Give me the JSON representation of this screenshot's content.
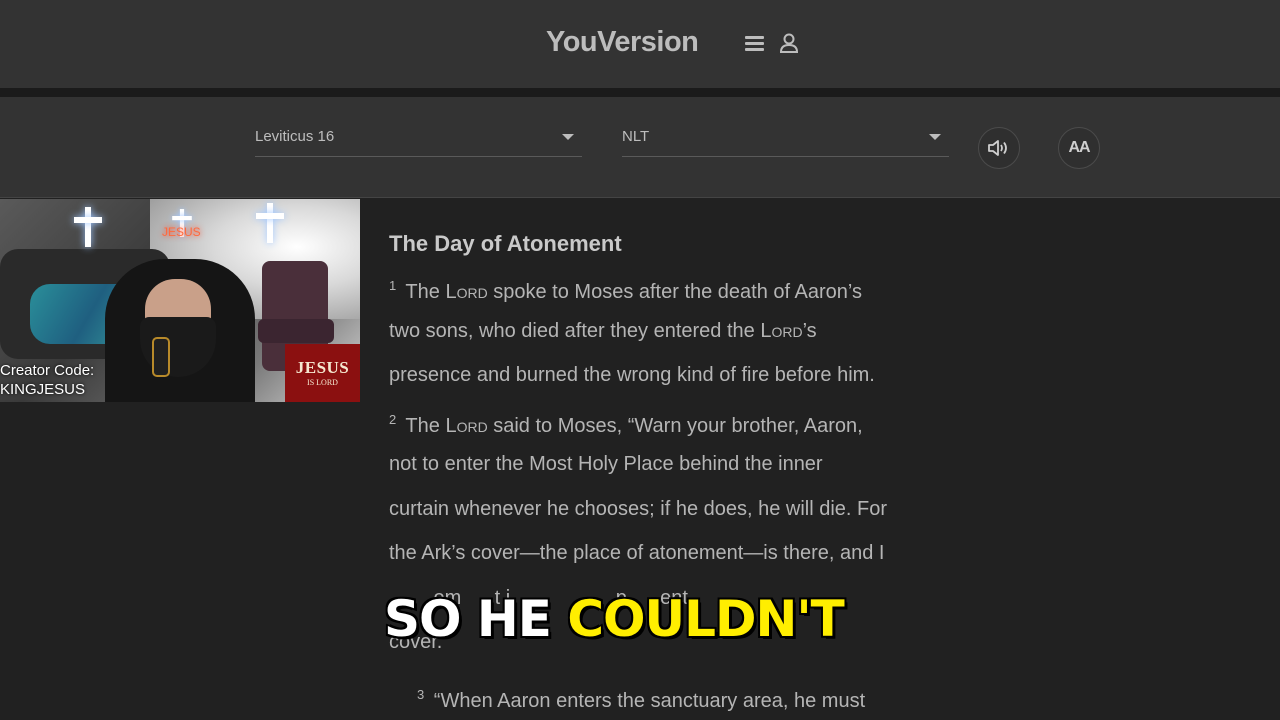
{
  "app": {
    "title": "YouVersion"
  },
  "header": {
    "menu_icon": "hamburger-menu-icon",
    "user_icon": "user-profile-icon"
  },
  "toolbar": {
    "book_select": {
      "value": "Leviticus 16"
    },
    "version_select": {
      "value": "NLT"
    },
    "audio_icon": "speaker-audio-icon",
    "font_button_label": "AA"
  },
  "webcam": {
    "creator_line1": "Creator Code:",
    "creator_line2": "KINGJESUS",
    "neon_sign": "JESUS",
    "badge_line1": "JESUS",
    "badge_line2": "IS LORD"
  },
  "reader": {
    "heading": "The Day of Atonement",
    "lines": [
      {
        "verse": "1",
        "parts": [
          " The ",
          {
            "sc": "Lord"
          },
          " spoke to Moses after the death of Aaron’s"
        ]
      },
      {
        "parts": [
          "two sons, who died after they entered the ",
          {
            "sc": "Lord"
          },
          "’s"
        ]
      },
      {
        "parts": [
          "presence and burned the wrong kind of fire before him."
        ]
      },
      {
        "verse": "2",
        "parts": [
          " The ",
          {
            "sc": "Lord"
          },
          " said to Moses, “Warn your brother, Aaron,"
        ]
      },
      {
        "parts": [
          "not to enter the Most Holy Place behind the inner"
        ]
      },
      {
        "parts": [
          "curtain whenever he chooses; if he does, he will die. For"
        ]
      },
      {
        "parts": [
          "the Ark’s cover—the place of atonement—is there, and I"
        ]
      },
      {
        "parts": [
          "        om      t i                   p      ent"
        ]
      },
      {
        "parts": [
          "cover."
        ]
      }
    ],
    "partial_verse": "3",
    "partial_text": " “When Aaron enters the sanctuary area, he must"
  },
  "caption": {
    "white": "SO HE ",
    "yellow": "COULDN'T"
  }
}
